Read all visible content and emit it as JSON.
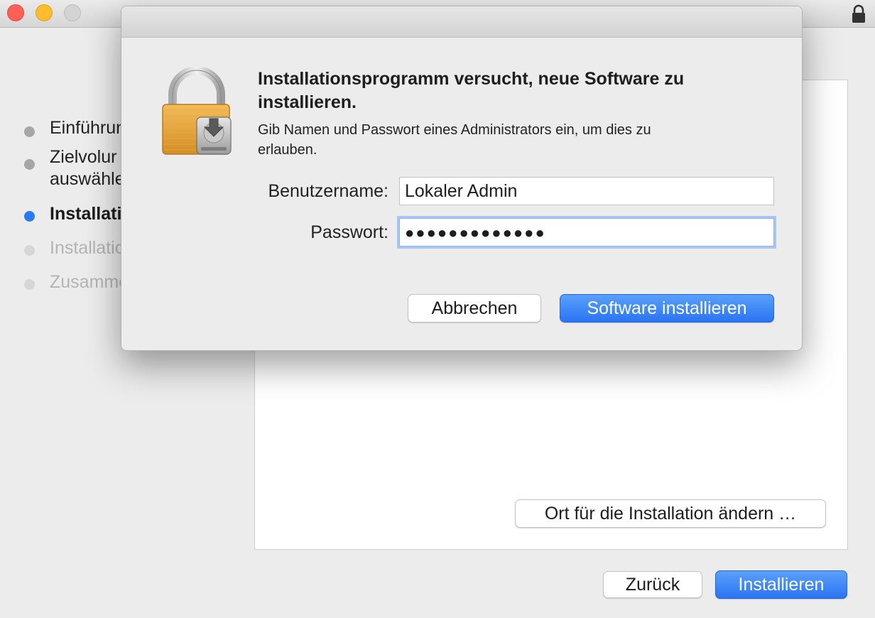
{
  "window": {
    "title_lock_icon": "lock-icon",
    "traffic_lights": {
      "close": "#fe5f57",
      "minimize": "#febc2e",
      "zoom": "#d3d3d3"
    }
  },
  "sidebar": {
    "steps": [
      {
        "label": "Einführung",
        "state": "done"
      },
      {
        "label": "Zielvolume auswählen",
        "line1": "Zielvolur",
        "line2": "auswähle",
        "state": "done"
      },
      {
        "label": "Installationstyp",
        "state": "current"
      },
      {
        "label": "Installation",
        "state": "pending"
      },
      {
        "label": "Zusammenfassung",
        "state": "pending"
      }
    ]
  },
  "main": {
    "change_location_label": "Ort für die Installation ändern …",
    "back_label": "Zurück",
    "install_label": "Installieren"
  },
  "dialog": {
    "icon": "lock-with-installer-disk-icon",
    "title": "Installationsprogramm versucht, neue Software zu installieren.",
    "message": "Gib Namen und Passwort eines Administrators ein, um dies zu erlauben.",
    "username_label": "Benutzername:",
    "username_value": "Lokaler Admin",
    "password_label": "Passwort:",
    "password_value": "●●●●●●●●●●●●●",
    "cancel_label": "Abbrechen",
    "confirm_label": "Software installieren"
  },
  "colors": {
    "accent": "#2a74f3",
    "step_done_dot": "#a6a6a6",
    "step_current_dot": "#2a7af5",
    "step_pending_dot": "#d6d6d6"
  }
}
